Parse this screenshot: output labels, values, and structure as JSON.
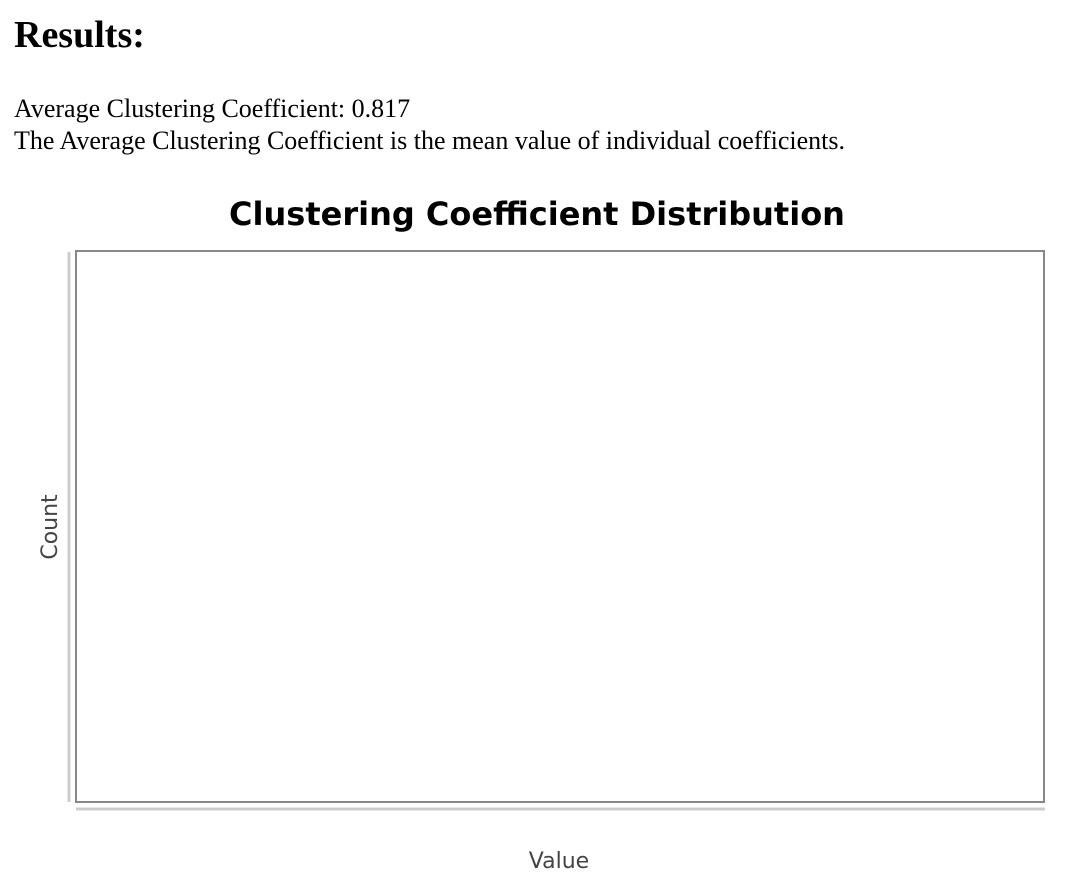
{
  "results": {
    "heading": "Results:",
    "average_line": "Average Clustering Coefficient: 0.817",
    "description": "The Average Clustering Coefficient is the mean value of individual coefficients."
  },
  "chart_data": {
    "type": "bar",
    "title": "Clustering Coefficient Distribution",
    "xlabel": "Value",
    "ylabel": "Count",
    "categories": [],
    "values": [],
    "grid": false,
    "legend": "none"
  },
  "colors": {
    "plot_border": "#888888",
    "axis_line": "#cccccc",
    "axis_label": "#444444",
    "background": "#ffffff"
  }
}
